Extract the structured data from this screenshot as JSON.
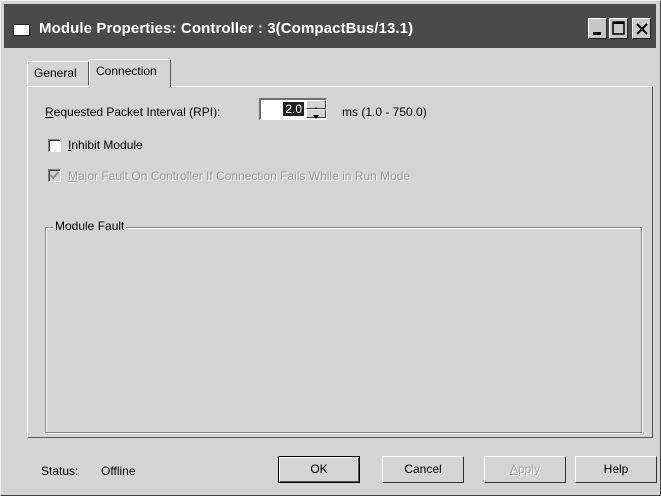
{
  "window": {
    "title": "Module Properties: Controller : 3(CompactBus/13.1)"
  },
  "tabs": [
    {
      "label": "General",
      "active": false
    },
    {
      "label": "Connection",
      "active": true
    }
  ],
  "rpi": {
    "label": "Requested Packet Interval (RPI):",
    "value": "2.0",
    "unit_range": "ms (1.0 - 750.0)"
  },
  "inhibit_module": {
    "label": "Inhibit Module",
    "checked": false
  },
  "major_fault": {
    "label": "Major Fault On Controller If Connection Fails While in Run Mode",
    "checked": true,
    "enabled": false
  },
  "module_fault": {
    "label": "Module Fault"
  },
  "status": {
    "label": "Status:",
    "value": "Offline"
  },
  "buttons": {
    "ok": "OK",
    "cancel": "Cancel",
    "apply": "Apply",
    "help": "Help"
  },
  "icons": {
    "window": "window-icon",
    "minimize": "minimize-icon",
    "maximize": "maximize-icon",
    "close": "close-icon",
    "spin_up": "spin-up-icon",
    "spin_down": "spin-down-icon"
  }
}
